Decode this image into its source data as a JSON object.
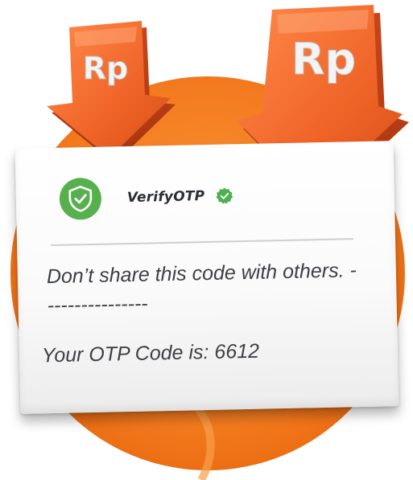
{
  "colors": {
    "orange_circle": "#f47b1f",
    "arrow_orange": "#ee6a2b",
    "shield_green": "#57b04e",
    "text_dark": "#3d3f44"
  },
  "arrows": [
    {
      "icon": "rupiah-down-arrow-icon",
      "label": "Rp"
    },
    {
      "icon": "rupiah-down-arrow-icon",
      "label": "Rp"
    }
  ],
  "notification": {
    "app_icon": "shield-check-icon",
    "app_name": "VerifyOTP",
    "verified_icon": "verified-badge-icon",
    "message": "Don’t share this code with others. ----------------",
    "otp_line": "Your OTP Code is: 6612"
  }
}
